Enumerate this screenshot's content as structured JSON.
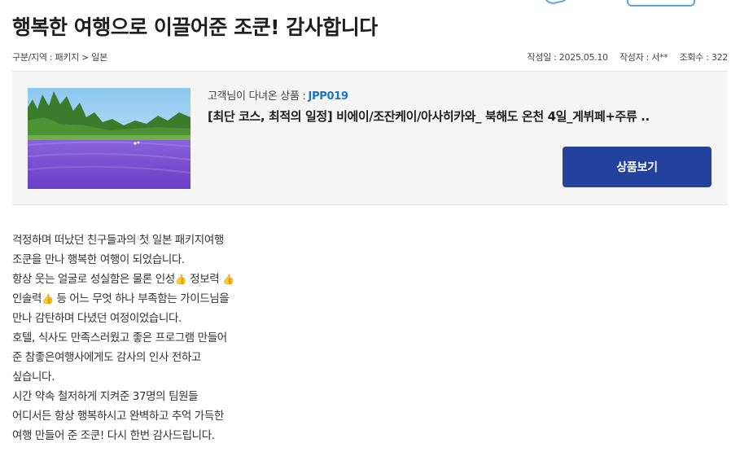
{
  "post": {
    "title": "행복한 여행으로 이끌어준 조쿤! 감사합니다",
    "breadcrumb": "구분/지역 : 패키지 > 일본",
    "date": "작성일 : 2025.05.10",
    "author": "작성자 : 서**",
    "views": "조회수 : 322"
  },
  "product": {
    "visited_label": "고객님이 다녀온 상품 :",
    "code": "JPP019",
    "name": "[최단 코스, 최적의 일정] 비에이/조잔케이/아사히카와_ 북해도 온천 4일_게뷔페+주류 ..",
    "view_button": "상품보기",
    "image": "lavender-field-photo"
  },
  "content": {
    "lines": [
      "걱정하며 떠났던 친구들과의 첫 일본 패키지여행",
      "조쿤을 만나 행복한 여행이 되었습니다.",
      [
        "항상 웃는 얼굴로 성실함은 물론 인성",
        "👍",
        " 정보력 ",
        "👍"
      ],
      [
        "인솔력",
        "👍",
        " 등 어느 무엇 하나 부족함는 가이드님을"
      ],
      "만나 감탄하며 다녔던 여정이었습니다.",
      "호텔, 식사도 만족스러웠고 좋은 프로그램 만들어",
      "준 참좋은여행사에게도 감사의 인사 전하고",
      "싶습니다.",
      "시간 약속 철저하게 지켜준 37명의 팀원들",
      "어디서든 항상 행복하시고  완벽하고 추억 가득한",
      "여행 만들어 준 조쿤! 다시 한번 감사드립니다."
    ]
  }
}
